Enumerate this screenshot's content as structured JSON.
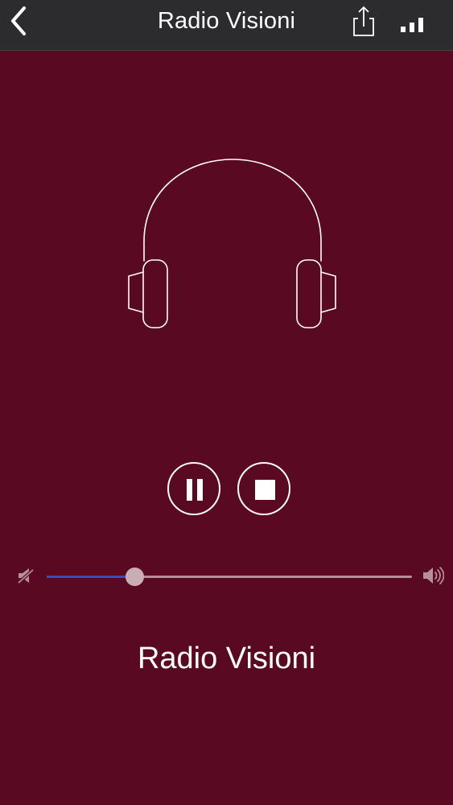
{
  "header": {
    "title": "Radio Visioni",
    "back_icon": "chevron-left-icon",
    "share_icon": "share-icon",
    "signal_icon": "signal-bars-icon"
  },
  "player": {
    "artwork_icon": "headphones-icon",
    "pause_icon": "pause-icon",
    "stop_icon": "stop-icon",
    "volume": {
      "level": 0.24,
      "min_icon": "volume-mute-icon",
      "max_icon": "volume-max-icon"
    },
    "station_name": "Radio Visioni"
  },
  "colors": {
    "background": "#5a0922",
    "nav_background": "#2c2c2e",
    "foreground": "#ffffff",
    "slider_fill": "#3d4bb5",
    "slider_track": "#b48e98"
  }
}
